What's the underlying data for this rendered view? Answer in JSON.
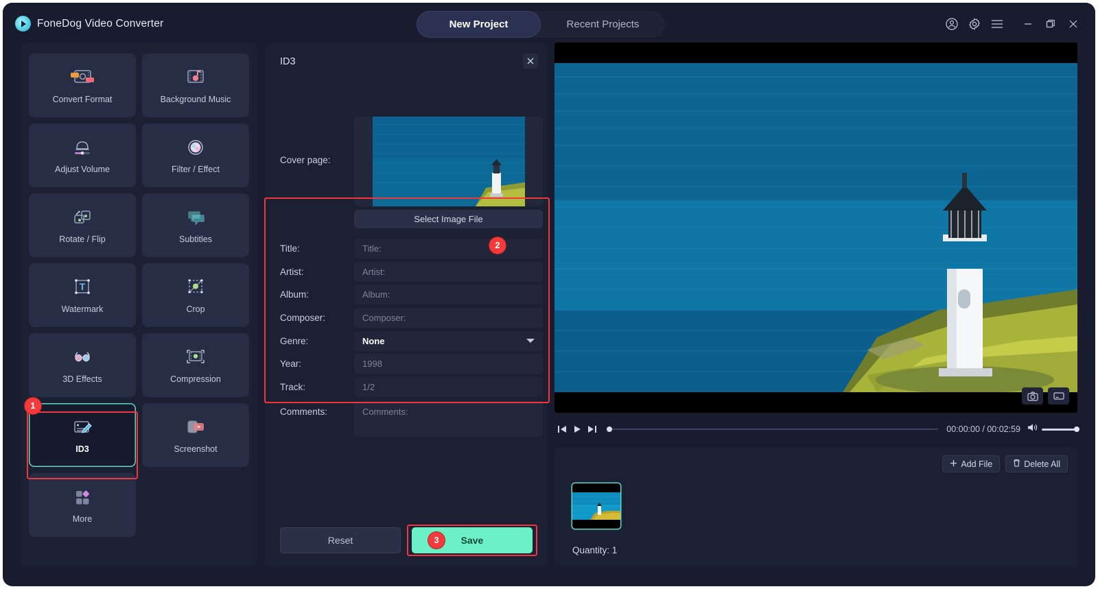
{
  "window": {
    "brand": "FoneDog Video Converter",
    "logo_icon": "play-circle-icon",
    "controls": [
      {
        "name": "account-icon",
        "label": "Account"
      },
      {
        "name": "gear-icon",
        "label": "Settings"
      },
      {
        "name": "hamburger-menu-icon",
        "label": "Menu"
      },
      {
        "name": "minimize-icon",
        "label": "Minimize"
      },
      {
        "name": "maximize-icon",
        "label": "Maximize"
      },
      {
        "name": "close-icon",
        "label": "Close"
      }
    ]
  },
  "tabs": [
    {
      "label": "New Project",
      "active": true
    },
    {
      "label": "Recent Projects",
      "active": false
    }
  ],
  "sidebar": {
    "tools": [
      {
        "label": "Convert Format",
        "icon": "convert-format-icon"
      },
      {
        "label": "Background Music",
        "icon": "background-music-icon"
      },
      {
        "label": "Adjust Volume",
        "icon": "adjust-volume-icon"
      },
      {
        "label": "Filter / Effect",
        "icon": "filter-effect-icon"
      },
      {
        "label": "Rotate / Flip",
        "icon": "rotate-flip-icon"
      },
      {
        "label": "Subtitles",
        "icon": "subtitles-icon"
      },
      {
        "label": "Watermark",
        "icon": "watermark-icon"
      },
      {
        "label": "Crop",
        "icon": "crop-icon"
      },
      {
        "label": "3D Effects",
        "icon": "3d-effects-icon"
      },
      {
        "label": "Compression",
        "icon": "compression-icon"
      },
      {
        "label": "ID3",
        "icon": "id3-icon"
      },
      {
        "label": "Screenshot",
        "icon": "screenshot-icon"
      },
      {
        "label": "More",
        "icon": "more-icon"
      }
    ]
  },
  "id3_panel": {
    "title": "ID3",
    "close_icon": "close-icon",
    "cover_label": "Cover page:",
    "select_image_button": "Select Image File",
    "fields": [
      {
        "label": "Title:",
        "placeholder": "Title:",
        "value": "",
        "type": "text"
      },
      {
        "label": "Artist:",
        "placeholder": "Artist:",
        "value": "",
        "type": "text"
      },
      {
        "label": "Album:",
        "placeholder": "Album:",
        "value": "",
        "type": "text"
      },
      {
        "label": "Composer:",
        "placeholder": "Composer:",
        "value": "",
        "type": "text"
      },
      {
        "label": "Genre:",
        "placeholder": "None",
        "value": "None",
        "type": "select"
      },
      {
        "label": "Year:",
        "placeholder": "1998",
        "value": "",
        "type": "text"
      },
      {
        "label": "Track:",
        "placeholder": "1/2",
        "value": "",
        "type": "text"
      }
    ],
    "comments_label": "Comments:",
    "comments_placeholder": "Comments:",
    "reset_button": "Reset",
    "save_button": "Save"
  },
  "annotations": {
    "badge_1": "1",
    "badge_2": "2",
    "badge_3": "3",
    "highlight_color": "#f4353c",
    "badge_color": "#f23b3b"
  },
  "player": {
    "timecode": "00:00:00 / 00:02:59",
    "current_time": "00:00:00",
    "duration": "00:02:59",
    "prev_icon": "skip-previous-icon",
    "play_icon": "play-icon",
    "next_icon": "skip-next-icon",
    "volume_icon": "volume-icon",
    "snapshot_icon": "camera-icon",
    "fullscreen_icon": "fullscreen-icon"
  },
  "file_list": {
    "add_file_button": "Add File",
    "add_icon": "plus-icon",
    "delete_all_button": "Delete All",
    "delete_icon": "trash-icon",
    "quantity_label": "Quantity: 1"
  },
  "theme": {
    "accent": "#6cf0c6",
    "panel_bg": "#1b2033",
    "window_bg": "#181c2e",
    "tile_bg": "#272d44"
  }
}
